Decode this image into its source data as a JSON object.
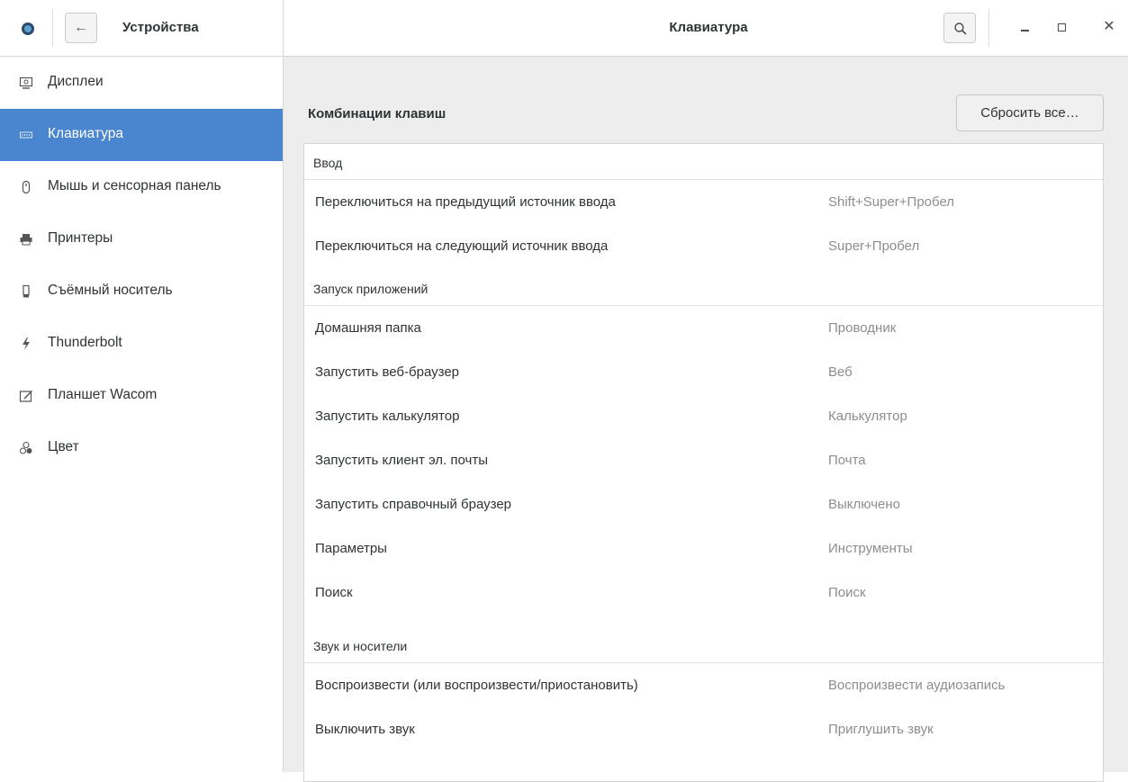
{
  "header": {
    "panel_title": "Устройства",
    "title": "Клавиатура"
  },
  "sidebar": {
    "items": [
      {
        "label": "Дисплеи",
        "icon": "display-icon"
      },
      {
        "label": "Клавиатура",
        "icon": "keyboard-icon",
        "active": true
      },
      {
        "label": "Мышь и сенсорная панель",
        "icon": "mouse-icon"
      },
      {
        "label": "Принтеры",
        "icon": "printer-icon"
      },
      {
        "label": "Съёмный носитель",
        "icon": "removable-media-icon"
      },
      {
        "label": "Thunderbolt",
        "icon": "thunderbolt-icon"
      },
      {
        "label": "Планшет Wacom",
        "icon": "tablet-icon"
      },
      {
        "label": "Цвет",
        "icon": "color-icon"
      }
    ]
  },
  "main": {
    "section_title": "Комбинации клавиш",
    "reset_label": "Сбросить все…",
    "groups": [
      {
        "title": "Ввод",
        "rows": [
          {
            "name": "Переключиться на предыдущий источник ввода",
            "accel": "Shift+Super+Пробел"
          },
          {
            "name": "Переключиться на следующий источник ввода",
            "accel": "Super+Пробел"
          }
        ]
      },
      {
        "title": "Запуск приложений",
        "rows": [
          {
            "name": "Домашняя папка",
            "accel": "Проводник"
          },
          {
            "name": "Запустить веб-браузер",
            "accel": "Веб"
          },
          {
            "name": "Запустить калькулятор",
            "accel": "Калькулятор"
          },
          {
            "name": "Запустить клиент эл. почты",
            "accel": "Почта"
          },
          {
            "name": "Запустить справочный браузер",
            "accel": "Выключено"
          },
          {
            "name": "Параметры",
            "accel": "Инструменты"
          },
          {
            "name": "Поиск",
            "accel": "Поиск"
          }
        ]
      },
      {
        "title": "Звук и носители",
        "rows": [
          {
            "name": "Воспроизвести (или воспроизвести/приостановить)",
            "accel": "Воспроизвести аудиозапись"
          },
          {
            "name": "Выключить звук",
            "accel": "Приглушить звук"
          }
        ]
      }
    ]
  },
  "colors": {
    "accent": "#4a86cf",
    "sidebar_bg": "#ffffff",
    "main_bg": "#ededed",
    "secondary_text": "#8b8e8f"
  }
}
